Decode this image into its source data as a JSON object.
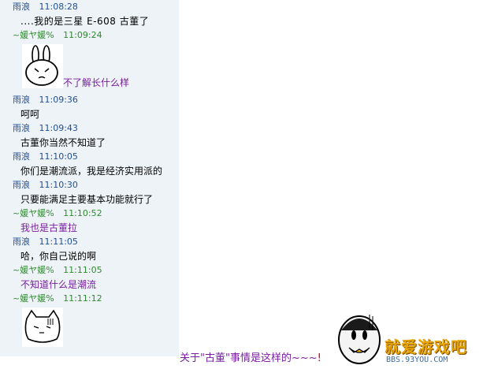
{
  "messages": [
    {
      "sender": "雨浪",
      "time": "11:08:28",
      "text": "....我的是三星 E-608 古董了"
    },
    {
      "sender": "~媛ヤ媛%",
      "time": "11:09:24",
      "caption": "不了解长什么样"
    },
    {
      "sender": "雨浪",
      "time": "11:09:36",
      "text": "呵呵"
    },
    {
      "sender": "雨浪",
      "time": "11:09:43",
      "text": "古董你当然不知道了"
    },
    {
      "sender": "雨浪",
      "time": "11:10:05",
      "text": "你们是潮流派，我是经济实用派的"
    },
    {
      "sender": "雨浪",
      "time": "11:10:30",
      "text": "只要能满足主要基本功能就行了"
    },
    {
      "sender": "~媛ヤ媛%",
      "time": "11:10:52",
      "text": "我也是古董拉"
    },
    {
      "sender": "雨浪",
      "time": "11:11:05",
      "text": "哈，你自己说的啊"
    },
    {
      "sender": "~媛ヤ媛%",
      "time": "11:11:05",
      "text": "不知道什么是潮流"
    },
    {
      "sender": "~媛ヤ媛%",
      "time": "11:11:12"
    }
  ],
  "bottom_caption": {
    "text": "关于\"古董\"事情是这样的~~~",
    "bang": "!"
  },
  "watermark": {
    "title": "就爱游戏吧",
    "site": "BBS.93YOU.COM"
  },
  "colors": {
    "sender_blue": "#1f4f9a",
    "sender_green": "#2e8b2e",
    "purple_text": "#7a1fa2",
    "chat_bg": "#eef3f7"
  }
}
